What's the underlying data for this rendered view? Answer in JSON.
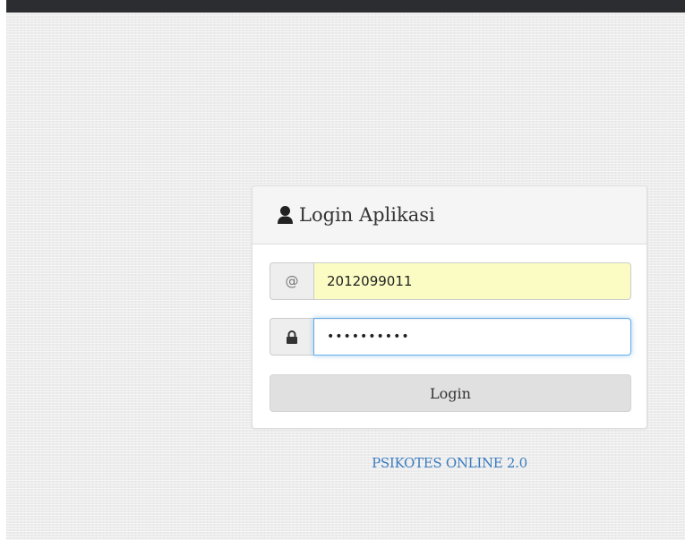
{
  "panel": {
    "title": "Login Aplikasi",
    "title_icon": "user-icon"
  },
  "username": {
    "addon": "@",
    "value": "2012099011",
    "state": "autofilled"
  },
  "password": {
    "addon_icon": "lock-icon",
    "masked_value": "••••••••••",
    "state": "focused"
  },
  "login_button": {
    "label": "Login"
  },
  "footer": {
    "link_text": "PSIKOTES ONLINE 2.0"
  },
  "colors": {
    "top_bar": "#2b2d31",
    "background": "#ececec",
    "autofill": "#fafcc3",
    "focus_border": "#66afe9",
    "link": "#3a7bbf",
    "button": "#e0e0e0"
  }
}
